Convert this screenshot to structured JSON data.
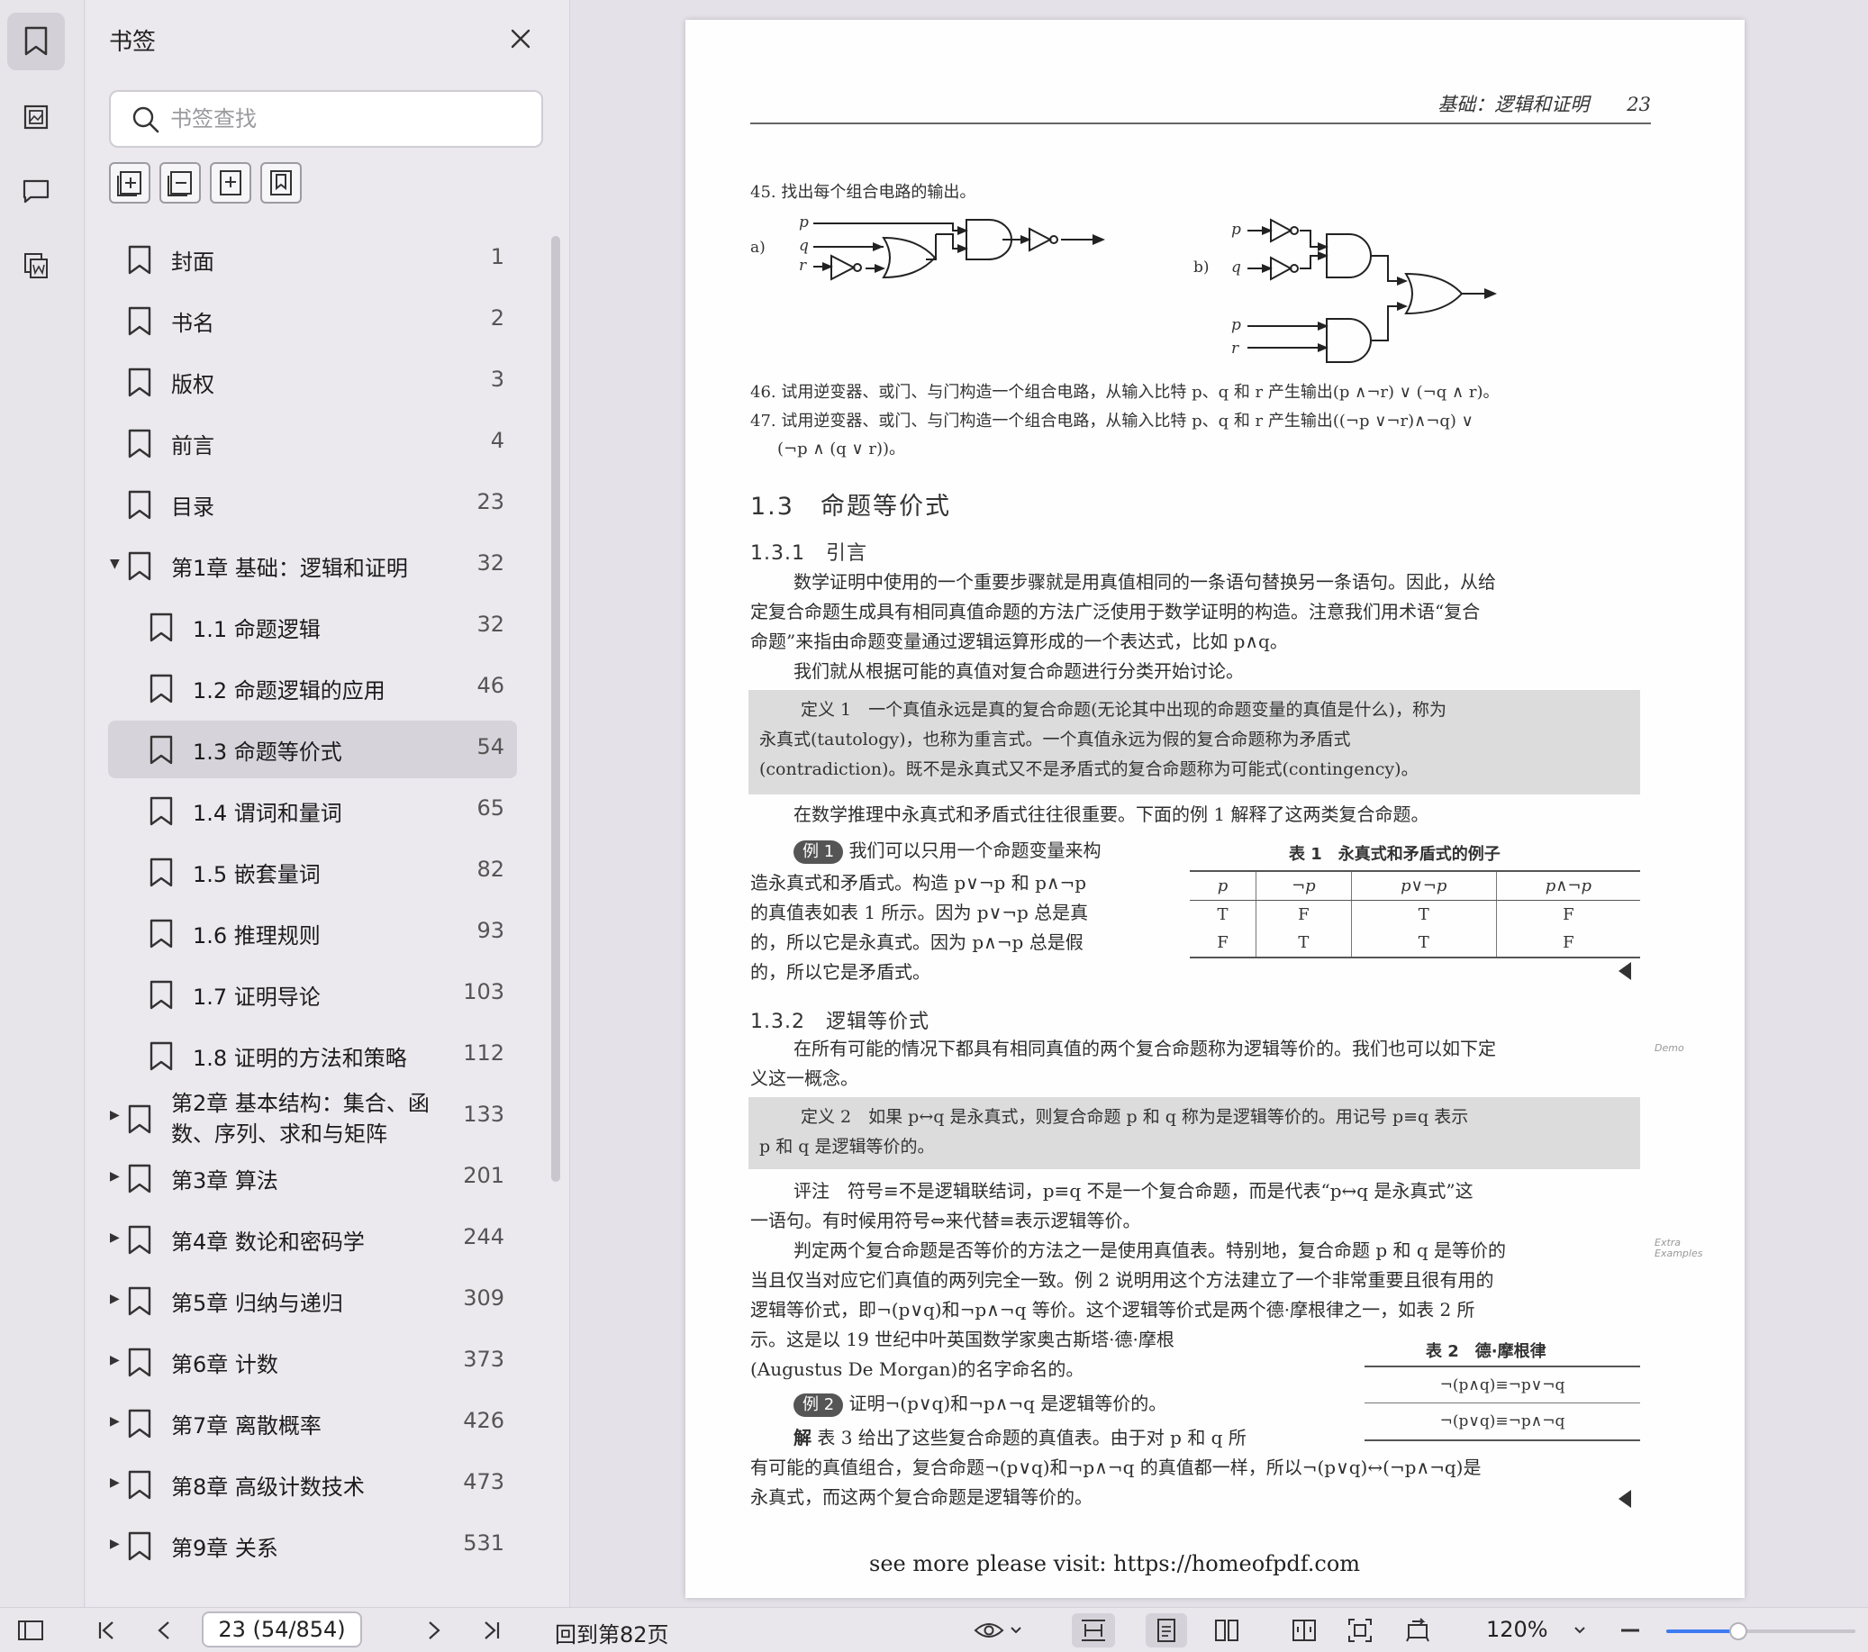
{
  "panel": {
    "title": "书签",
    "search_placeholder": "书签查找"
  },
  "bookmarks": [
    {
      "label": "封面",
      "page": "1",
      "level": 0,
      "caret": ""
    },
    {
      "label": "书名",
      "page": "2",
      "level": 0,
      "caret": ""
    },
    {
      "label": "版权",
      "page": "3",
      "level": 0,
      "caret": ""
    },
    {
      "label": "前言",
      "page": "4",
      "level": 0,
      "caret": ""
    },
    {
      "label": "目录",
      "page": "23",
      "level": 0,
      "caret": ""
    },
    {
      "label": "第1章 基础：逻辑和证明",
      "page": "32",
      "level": 0,
      "caret": "expanded"
    },
    {
      "label": "1.1 命题逻辑",
      "page": "32",
      "level": 1,
      "caret": ""
    },
    {
      "label": "1.2 命题逻辑的应用",
      "page": "46",
      "level": 1,
      "caret": ""
    },
    {
      "label": "1.3 命题等价式",
      "page": "54",
      "level": 1,
      "caret": "",
      "selected": true
    },
    {
      "label": "1.4 谓词和量词",
      "page": "65",
      "level": 1,
      "caret": ""
    },
    {
      "label": "1.5 嵌套量词",
      "page": "82",
      "level": 1,
      "caret": ""
    },
    {
      "label": "1.6 推理规则",
      "page": "93",
      "level": 1,
      "caret": ""
    },
    {
      "label": "1.7 证明导论",
      "page": "103",
      "level": 1,
      "caret": ""
    },
    {
      "label": "1.8 证明的方法和策略",
      "page": "112",
      "level": 1,
      "caret": ""
    },
    {
      "label": "第2章 基本结构：集合、函数、序列、求和与矩阵",
      "page": "133",
      "level": 0,
      "caret": "collapsed",
      "twoline": true
    },
    {
      "label": "第3章 算法",
      "page": "201",
      "level": 0,
      "caret": "collapsed"
    },
    {
      "label": "第4章 数论和密码学",
      "page": "244",
      "level": 0,
      "caret": "collapsed"
    },
    {
      "label": "第5章 归纳与递归",
      "page": "309",
      "level": 0,
      "caret": "collapsed"
    },
    {
      "label": "第6章 计数",
      "page": "373",
      "level": 0,
      "caret": "collapsed"
    },
    {
      "label": "第7章 离散概率",
      "page": "426",
      "level": 0,
      "caret": "collapsed"
    },
    {
      "label": "第8章 高级计数技术",
      "page": "473",
      "level": 0,
      "caret": "collapsed"
    },
    {
      "label": "第9章 关系",
      "page": "531",
      "level": 0,
      "caret": "collapsed"
    }
  ],
  "document": {
    "running_head": "基础：逻辑和证明　　23",
    "ex45": "45. 找出每个组合电路的输出。",
    "circuit_a_label": "a)",
    "circuit_b_label": "b)",
    "var_p": "p",
    "var_q": "q",
    "var_r": "r",
    "ex46": "46. 试用逆变器、或门、与门构造一个组合电路，从输入比特 p、q 和 r 产生输出(p ∧¬r) ∨ (¬q ∧ r)。",
    "ex47a": "47. 试用逆变器、或门、与门构造一个组合电路，从输入比特 p、q 和 r 产生输出((¬p ∨¬r)∧¬q) ∨",
    "ex47b": "(¬p ∧ (q ∨ r))。",
    "sec13": "1.3　命题等价式",
    "sec131": "1.3.1　引言",
    "intro1": "数学证明中使用的一个重要步骤就是用真值相同的一条语句替换另一条语句。因此，从给",
    "intro2": "定复合命题生成具有相同真值命题的方法广泛使用于数学证明的构造。注意我们用术语“复合",
    "intro3": "命题”来指由命题变量通过逻辑运算形成的一个表达式，比如 p∧q。",
    "intro4": "我们就从根据可能的真值对复合命题进行分类开始讨论。",
    "def1_1": "定义 1　一个真值永远是真的复合命题(无论其中出现的命题变量的真值是什么)，称为",
    "def1_2": "永真式(tautology)，也称为重言式。一个真值永远为假的复合命题称为矛盾式",
    "def1_3": "(contradiction)。既不是永真式又不是矛盾式的复合命题称为可能式(contingency)。",
    "after_def1": "在数学推理中永真式和矛盾式往往很重要。下面的例 1 解释了这两类复合命题。",
    "ex1_badge": "例 1",
    "ex1_1": "我们可以只用一个命题变量来构",
    "ex1_2": "造永真式和矛盾式。构造 p∨¬p 和 p∧¬p",
    "ex1_3": "的真值表如表 1 所示。因为 p∨¬p 总是真",
    "ex1_4": "的，所以它是永真式。因为 p∧¬p 总是假",
    "ex1_5": "的，所以它是矛盾式。",
    "table1": {
      "caption": "表 1　永真式和矛盾式的例子",
      "headers": [
        "p",
        "¬p",
        "p∨¬p",
        "p∧¬p"
      ],
      "rows": [
        [
          "T",
          "F",
          "T",
          "F"
        ],
        [
          "F",
          "T",
          "T",
          "F"
        ]
      ]
    },
    "sec132": "1.3.2　逻辑等价式",
    "le1": "在所有可能的情况下都具有相同真值的两个复合命题称为逻辑等价的。我们也可以如下定",
    "le2": "义这一概念。",
    "side_demo": "Demo",
    "def2_1": "定义 2　如果 p↔q 是永真式，则复合命题 p 和 q 称为是逻辑等价的。用记号 p≡q 表示",
    "def2_2": "p 和 q 是逻辑等价的。",
    "rem1": "评注　符号≡不是逻辑联结词，p≡q 不是一个复合命题，而是代表“p↔q 是永真式”这",
    "rem2": "一语句。有时候用符号⇔来代替≡表示逻辑等价。",
    "side_extra": "Extra Examples",
    "j1": "判定两个复合命题是否等价的方法之一是使用真值表。特别地，复合命题 p 和 q 是等价的",
    "j2": "当且仅当对应它们真值的两列完全一致。例 2 说明用这个方法建立了一个非常重要且很有用的",
    "j3": "逻辑等价式，即¬(p∨q)和¬p∧¬q 等价。这个逻辑等价式是两个德·摩根律之一，如表 2 所",
    "j4": "示。这是以 19 世纪中叶英国数学家奥古斯塔·德·摩根",
    "j5": "(Augustus De Morgan)的名字命名的。",
    "table2": {
      "caption": "表 2　德·摩根律",
      "rows": [
        "¬(p∧q)≡¬p∨¬q",
        "¬(p∨q)≡¬p∧¬q"
      ]
    },
    "ex2_badge": "例 2",
    "ex2": "证明¬(p∨q)和¬p∧¬q 是逻辑等价的。",
    "sol1_label": "解",
    "sol1": "表 3 给出了这些复合命题的真值表。由于对 p 和 q 所",
    "sol2": "有可能的真值组合，复合命题¬(p∨q)和¬p∧¬q 的真值都一样，所以¬(p∨q)↔(¬p∧¬q)是",
    "sol3": "永真式，而这两个复合命题是逻辑等价的。",
    "footer_url": "see more please visit: https://homeofpdf.com"
  },
  "statusbar": {
    "page_value": "23 (54/854)",
    "goto_label": "回到第82页",
    "zoom": "120%",
    "zoom_fraction": 0.38
  }
}
